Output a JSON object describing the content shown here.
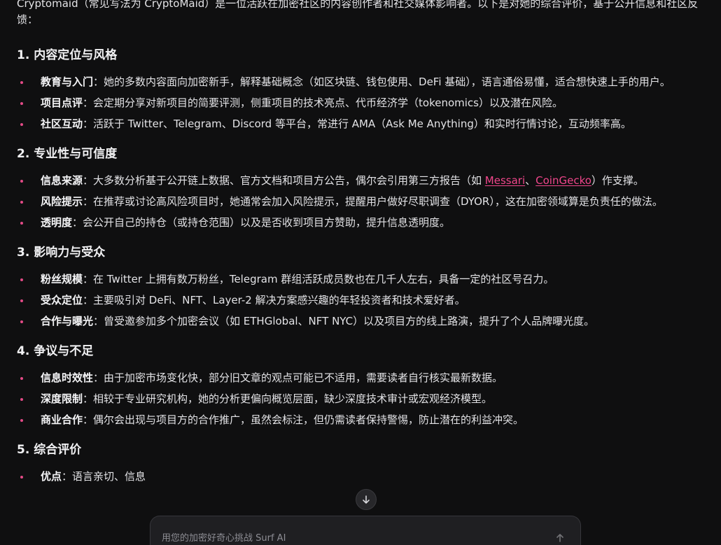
{
  "intro": "Cryptomaid（常见写法为 CryptoMaid）是一位活跃在加密社区的内容创作者和社交媒体影响者。以下是对她的综合评价，基于公开信息和社区反馈：",
  "sections": [
    {
      "title": "1. 内容定位与风格",
      "items": [
        {
          "label": "教育与入门",
          "text": "：她的多数内容面向加密新手，解释基础概念（如区块链、钱包使用、DeFi 基础），语言通俗易懂，适合想快速上手的用户。"
        },
        {
          "label": "项目点评",
          "text": "：会定期分享对新项目的简要评测，侧重项目的技术亮点、代币经济学（tokenomics）以及潜在风险。"
        },
        {
          "label": "社区互动",
          "text": "：活跃于 Twitter、Telegram、Discord 等平台，常进行 AMA（Ask Me Anything）和实时行情讨论，互动频率高。"
        }
      ]
    },
    {
      "title": "2. 专业性与可信度",
      "items": [
        {
          "label": "信息来源",
          "text_before": "：大多数分析基于公开链上数据、官方文档和项目方公告，偶尔会引用第三方报告（如 ",
          "link1": "Messari",
          "sep": "、",
          "link2": "CoinGecko",
          "text_after": "）作支撑。"
        },
        {
          "label": "风险提示",
          "text": "：在推荐或讨论高风险项目时，她通常会加入风险提示，提醒用户做好尽职调查（DYOR），这在加密领域算是负责任的做法。"
        },
        {
          "label": "透明度",
          "text": "：会公开自己的持仓（或持仓范围）以及是否收到项目方赞助，提升信息透明度。"
        }
      ]
    },
    {
      "title": "3. 影响力与受众",
      "items": [
        {
          "label": "粉丝规模",
          "text": "：在 Twitter 上拥有数万粉丝，Telegram 群组活跃成员数也在几千人左右，具备一定的社区号召力。"
        },
        {
          "label": "受众定位",
          "text": "：主要吸引对 DeFi、NFT、Layer-2 解决方案感兴趣的年轻投资者和技术爱好者。"
        },
        {
          "label": "合作与曝光",
          "text": "：曾受邀参加多个加密会议（如 ETHGlobal、NFT NYC）以及项目方的线上路演，提升了个人品牌曝光度。"
        }
      ]
    },
    {
      "title": "4. 争议与不足",
      "items": [
        {
          "label": "信息时效性",
          "text": "：由于加密市场变化快，部分旧文章的观点可能已不适用，需要读者自行核实最新数据。"
        },
        {
          "label": "深度限制",
          "text": "：相较于专业研究机构，她的分析更偏向概览层面，缺少深度技术审计或宏观经济模型。"
        },
        {
          "label": "商业合作",
          "text": "：偶尔会出现与项目方的合作推广，虽然会标注，但仍需读者保持警惕，防止潜在的利益冲突。"
        }
      ]
    },
    {
      "title": "5. 综合评价",
      "items": [
        {
          "label": "优点",
          "text": "：语言亲切、信息"
        }
      ]
    }
  ],
  "chat": {
    "placeholder": "用您的加密好奇心挑战 Surf AI"
  },
  "icons": {
    "scroll": "arrow-down-icon",
    "send": "arrow-up-icon"
  },
  "colors": {
    "background": "#0f0f10",
    "bullet": "#e34b86",
    "link": "#f0468b"
  }
}
